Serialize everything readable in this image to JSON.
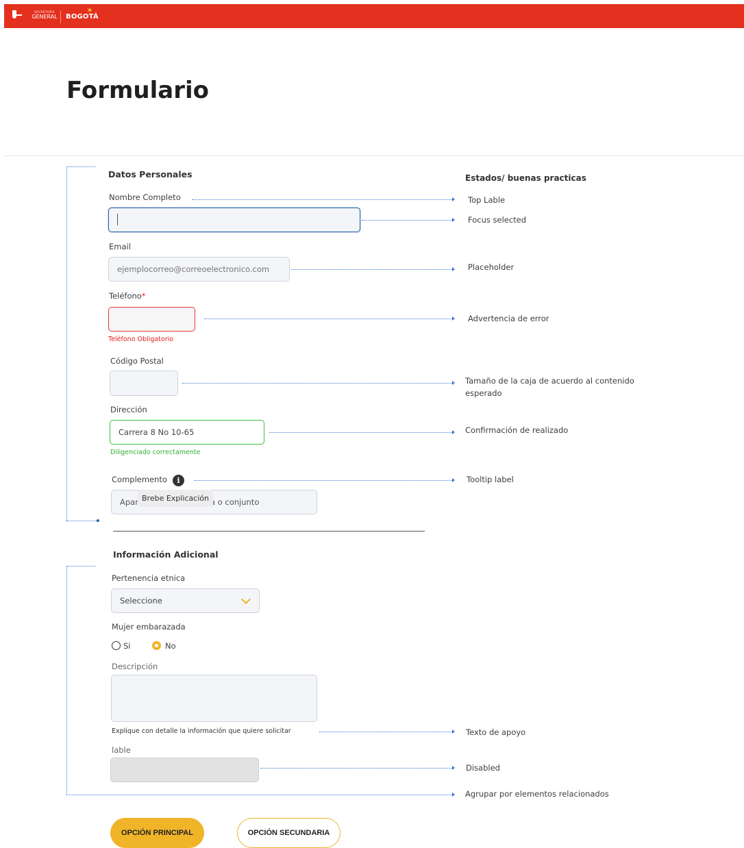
{
  "header": {
    "logo_line1": "SECRETARÍA",
    "logo_line2": "GENERAL",
    "logo_city": "BOGOTÁ"
  },
  "page": {
    "title": "Formulario"
  },
  "notes_heading": "Estados/ buenas practicas",
  "personal": {
    "title": "Datos Personales",
    "name_label": "Nombre Completo",
    "name_value": "",
    "email_label": "Email",
    "email_placeholder": "ejemplocorreo@correoelectronico.com",
    "phone_label": "Teléfono",
    "phone_required_mark": "*",
    "phone_error": "Teléfono Obligatorio",
    "postal_label": "Código Postal",
    "address_label": "Dirección",
    "address_value": "Carrera 8 No 10-65",
    "address_success": "Diligenciado correctamente",
    "complement_label": "Complemento",
    "complement_placeholder_start": "Apar",
    "complement_placeholder_end": "sa o conjunto",
    "tooltip": "Brebe Explicación"
  },
  "notes": {
    "top_label": "Top Lable",
    "focus": "Focus selected",
    "placeholder": "Placeholder",
    "error": "Advertencia de error",
    "size_line1": "Tamaño de la caja de acuerdo al contenido",
    "size_line2": "esperado",
    "confirm": "Confirmación de realizado",
    "tooltip": "Tooltip label",
    "support": "Texto de apoyo",
    "disabled": "Disabled",
    "group": "Agrupar por elementos relacionados"
  },
  "additional": {
    "title": "Información Adicional",
    "ethnic_label": "Pertenencia etnica",
    "ethnic_selected": "Seleccione",
    "pregnant_label": "Mujer embarazada",
    "option_yes": "Si",
    "option_no": "No",
    "selected_option": "No",
    "description_label": "Descripción",
    "description_helper": "Explique con detalle la información que quiere solicitar",
    "disabled_label": "lable"
  },
  "actions": {
    "primary": "OPCIÓN PRINCIPAL",
    "secondary": "OPCIÓN SECUNDARIA"
  },
  "colors": {
    "brand_red": "#e4301e",
    "accent_yellow": "#f0b429",
    "focus_blue": "#2d63a8",
    "error_red": "#e21d1d",
    "success_green": "#3fbe3f",
    "guide_blue": "#3a7bd5"
  }
}
